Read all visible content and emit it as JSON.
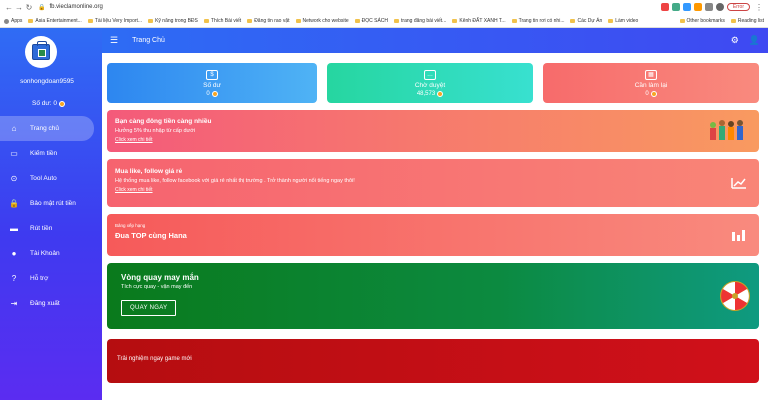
{
  "browser": {
    "url": "fb.vieclamonline.org",
    "error_label": "Error",
    "bookmarks": [
      "Apps",
      "Asia Entertainment...",
      "Tài liệu Very Import...",
      "Kỹ năng trong BĐS",
      "Thích Bài viết",
      "Đăng tin rao vặt",
      "Network cho website",
      "ĐỌC SÁCH",
      "trang đăng bài viết...",
      "Kênh ĐẤT XANH T...",
      "Trang tin rơi có nhi...",
      "Các Dự Án",
      "Làm video"
    ],
    "bookmarks_right": [
      "Other bookmarks",
      "Reading list"
    ]
  },
  "sidebar": {
    "username": "sonhongdoan9595",
    "balance_label": "Số dư: 0",
    "items": [
      {
        "label": "Trang chủ",
        "icon": "home-icon",
        "active": true
      },
      {
        "label": "Kiếm tiền",
        "icon": "wallet-icon",
        "active": false
      },
      {
        "label": "Tool Auto",
        "icon": "auto-icon",
        "active": false
      },
      {
        "label": "Bảo mật rút tiền",
        "icon": "lock-icon",
        "active": false
      },
      {
        "label": "Rút tiền",
        "icon": "card-icon",
        "active": false
      },
      {
        "label": "Tài Khoản",
        "icon": "user-icon",
        "active": false
      },
      {
        "label": "Hỗ trợ",
        "icon": "help-icon",
        "active": false
      },
      {
        "label": "Đăng xuất",
        "icon": "logout-icon",
        "active": false
      }
    ]
  },
  "topbar": {
    "title": "Trang Chủ"
  },
  "stats": [
    {
      "label": "Số dư",
      "value": "0"
    },
    {
      "label": "Chờ duyệt",
      "value": "48,573"
    },
    {
      "label": "Cần làm lại",
      "value": "0"
    }
  ],
  "cards": {
    "referral": {
      "title": "Bạn càng đông tiền càng nhiều",
      "desc": "Hưởng 5% thu nhập từ cấp dưới",
      "link": "Click xem chi tiết"
    },
    "likes": {
      "title": "Mua like, follow giá rẻ",
      "desc": "Hệ thống mua like, follow facebook với giá rẻ nhất thị trường . Trở thành người nổi tiếng ngay thôi!",
      "link": "Click xem chi tiết"
    },
    "ranking": {
      "small": "Bảng xếp hạng",
      "title": "Đua TOP cùng Hana"
    },
    "wheel": {
      "title": "Vòng quay may mắn",
      "desc": "Tích cực quay - vận may đến",
      "button": "QUAY NGAY"
    },
    "game": {
      "desc": "Trải nghiệm ngay game mới"
    }
  },
  "colors": {
    "sidebar_top": "#2f6cf4",
    "sidebar_bottom": "#5b2cf1",
    "accent": "#2d6cf4"
  }
}
